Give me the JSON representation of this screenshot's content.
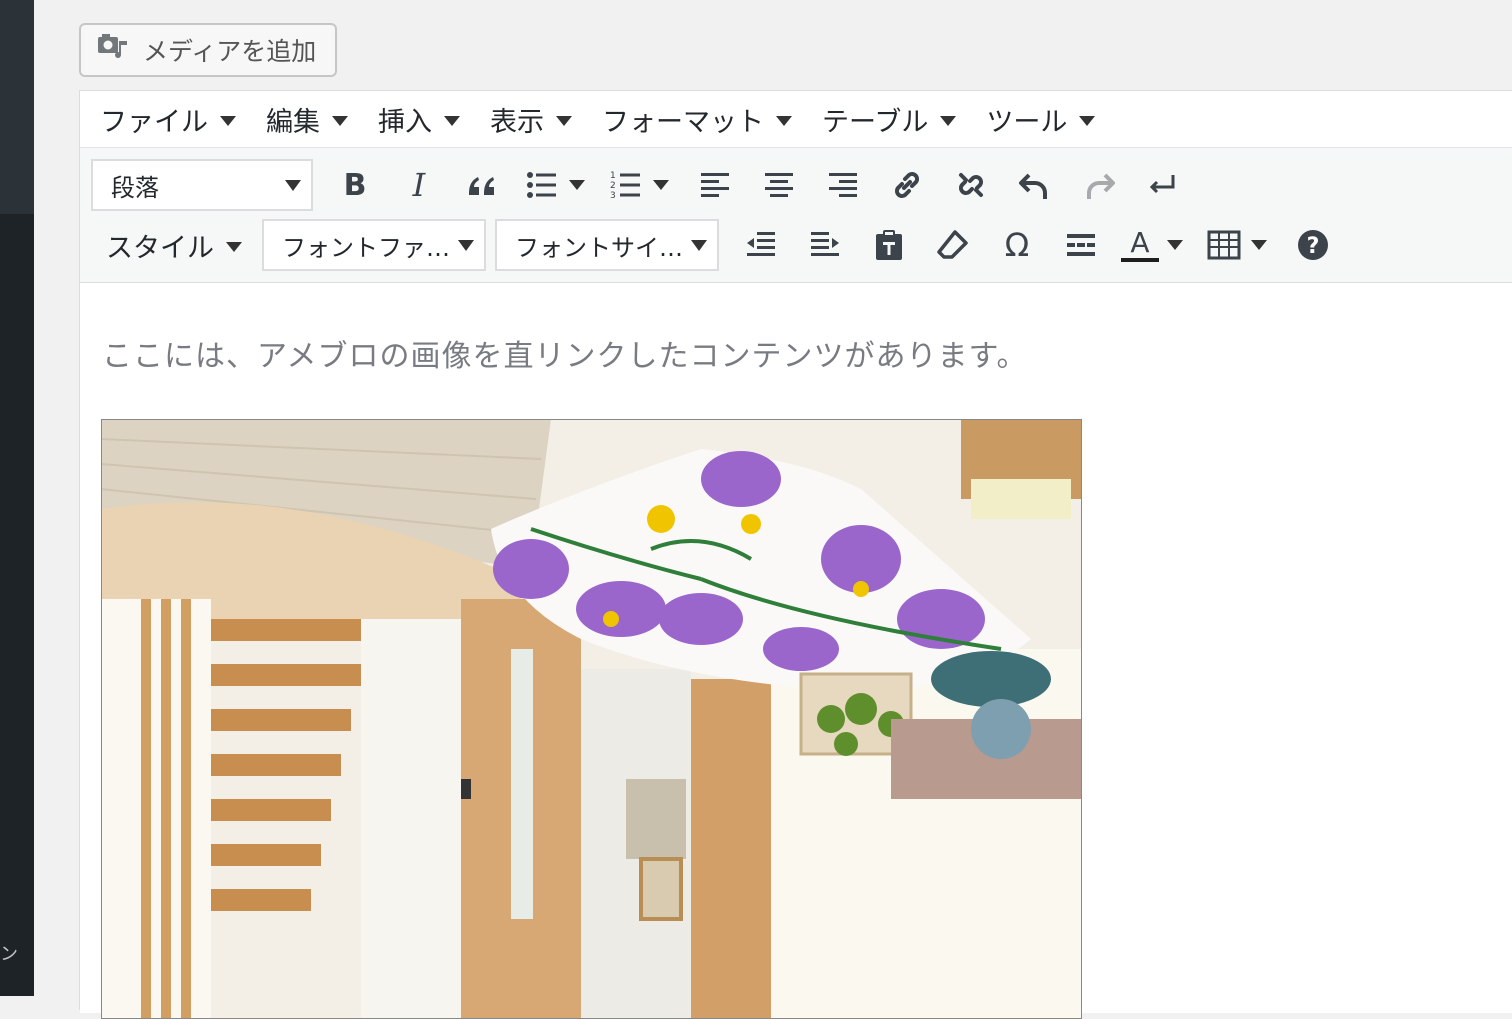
{
  "media_button": {
    "label": "メディアを追加",
    "icon": "media-icon"
  },
  "menubar": {
    "items": [
      {
        "label": "ファイル"
      },
      {
        "label": "編集"
      },
      {
        "label": "挿入"
      },
      {
        "label": "表示"
      },
      {
        "label": "フォーマット"
      },
      {
        "label": "テーブル"
      },
      {
        "label": "ツール"
      }
    ]
  },
  "toolbar": {
    "format_select": "段落",
    "styles_label": "スタイル",
    "font_family_select": "フォントファ…",
    "font_size_select": "フォントサイ…",
    "row1_icons": [
      "bold-icon",
      "italic-icon",
      "blockquote-icon",
      "bullet-list-icon",
      "numbered-list-icon",
      "align-left-icon",
      "align-center-icon",
      "align-right-icon",
      "link-icon",
      "unlink-icon",
      "undo-icon",
      "redo-icon",
      "line-break-icon"
    ],
    "row2_icons": [
      "outdent-icon",
      "indent-icon",
      "paste-as-text-icon",
      "clear-format-icon",
      "special-character-icon",
      "horizontal-rule-icon",
      "text-color-icon",
      "table-icon",
      "help-icon"
    ],
    "bold_glyph": "B",
    "italic_glyph": "I",
    "omega_glyph": "Ω",
    "text_color_glyph": "A",
    "help_glyph": "?"
  },
  "content": {
    "paragraph": "ここには、アメブロの画像を直リンクしたコンテンツがあります。",
    "image": "interior-photo"
  },
  "colors": {
    "sidebar": "#1d2327",
    "toolbar_bg": "#f6f7f7",
    "text": "#23282d",
    "muted_text": "#787c82"
  }
}
